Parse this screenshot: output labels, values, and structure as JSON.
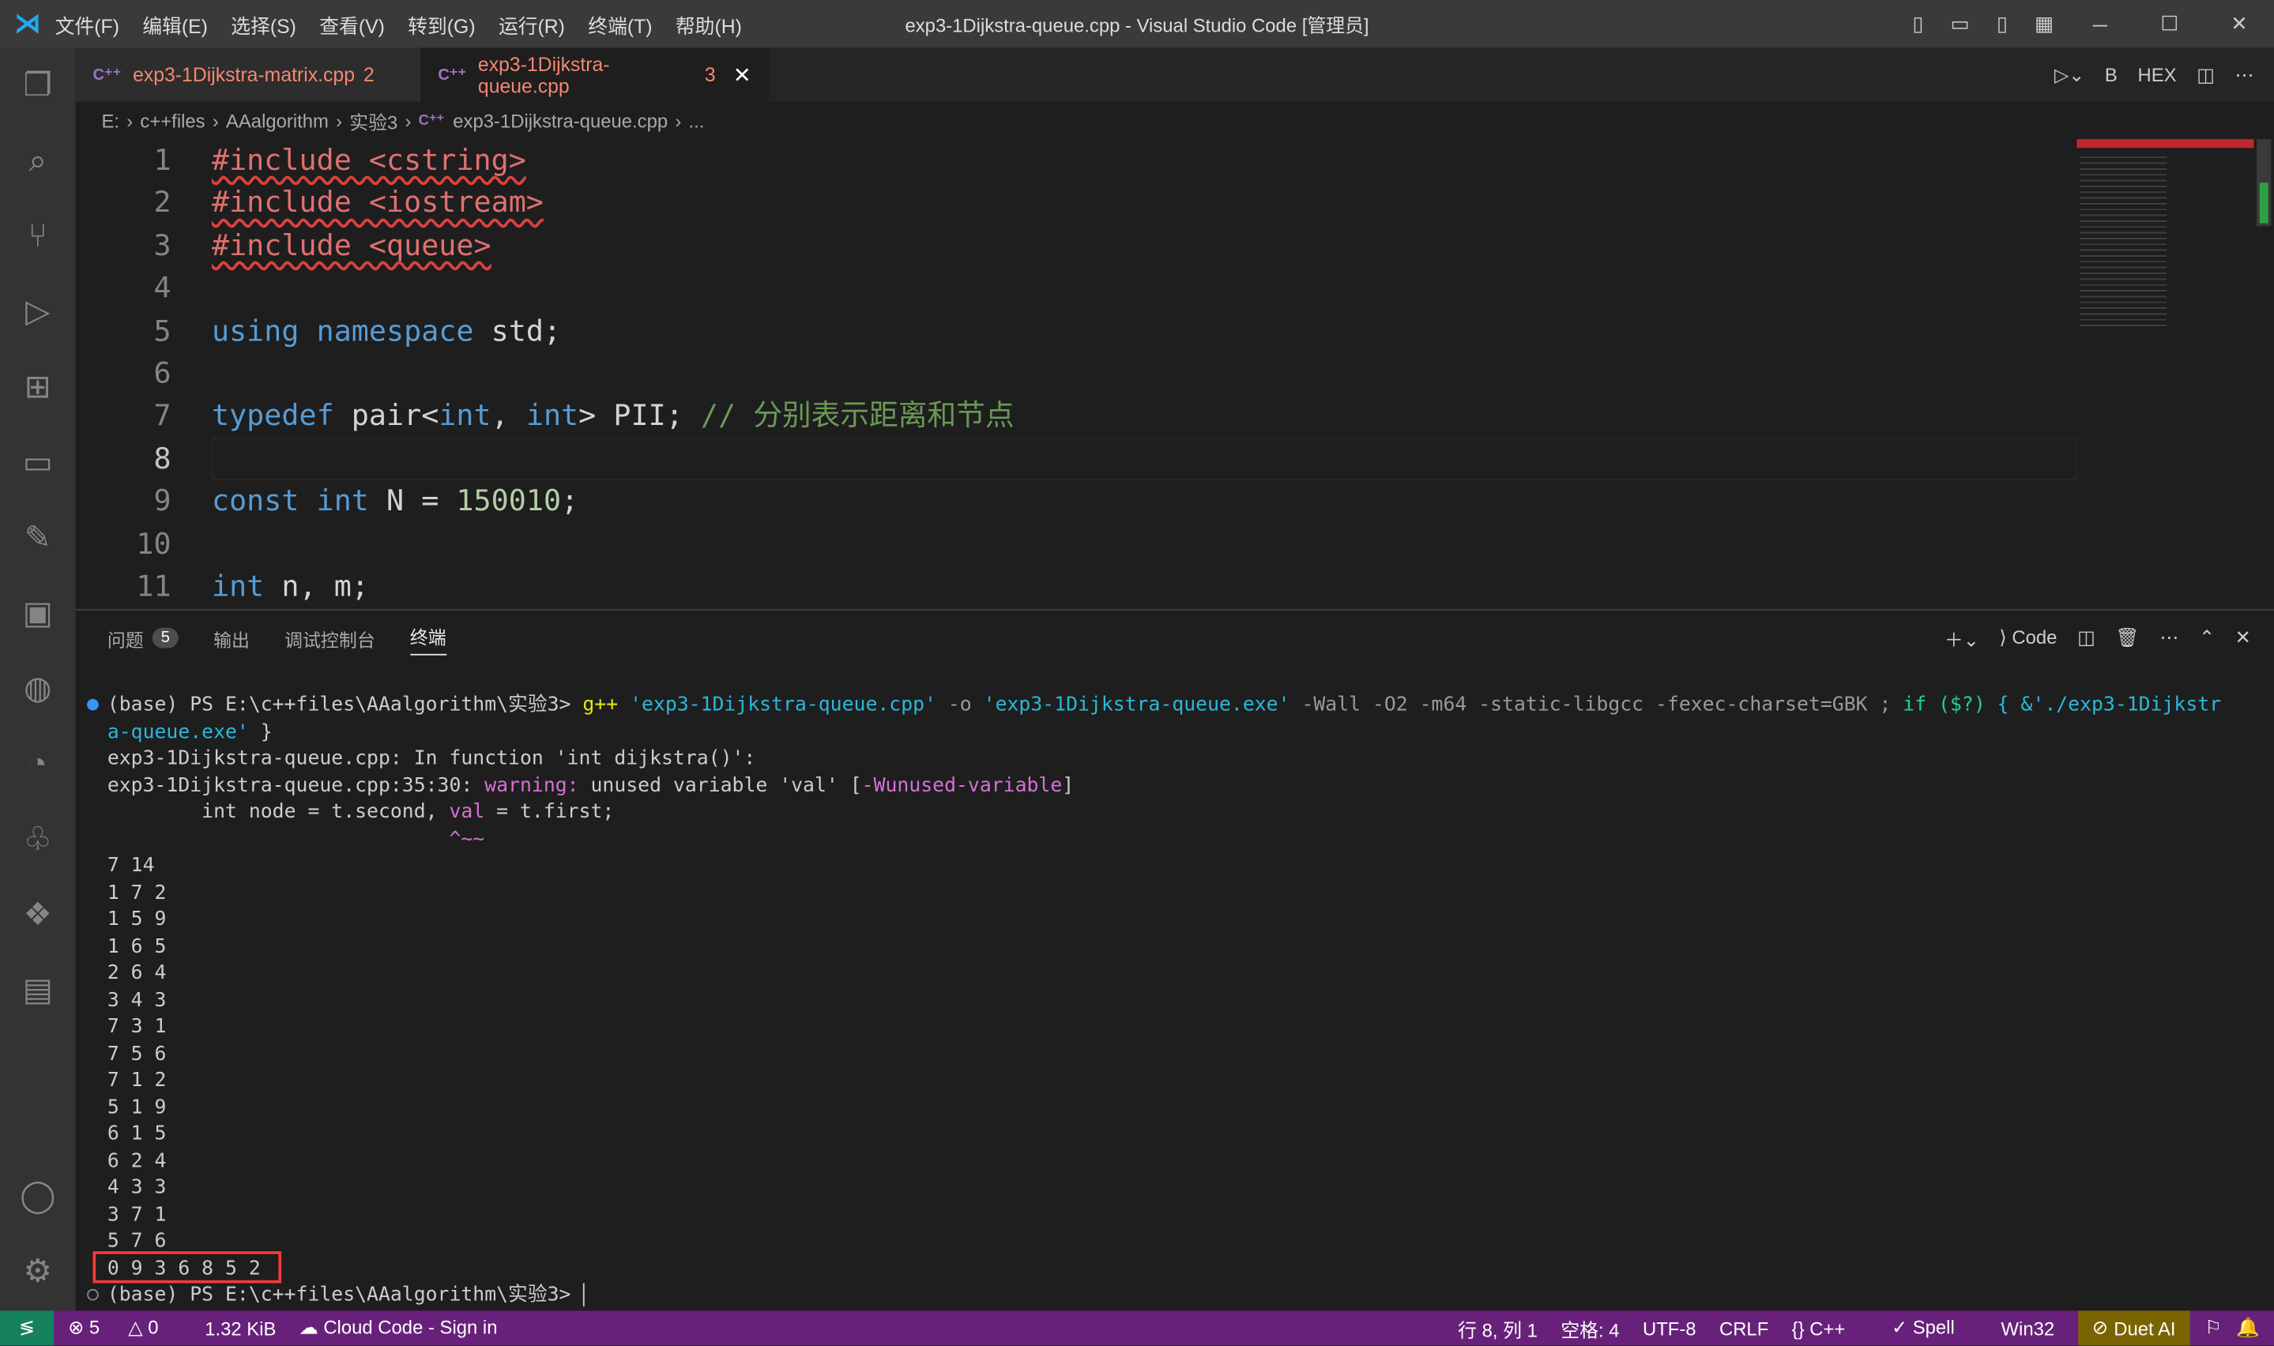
{
  "window": {
    "title": "exp3-1Dijkstra-queue.cpp - Visual Studio Code [管理员]"
  },
  "menu": [
    "文件(F)",
    "编辑(E)",
    "选择(S)",
    "查看(V)",
    "转到(G)",
    "运行(R)",
    "终端(T)",
    "帮助(H)"
  ],
  "tabs": [
    {
      "label": "exp3-1Dijkstra-matrix.cpp",
      "problems": "2",
      "active": false
    },
    {
      "label": "exp3-1Dijkstra-queue.cpp",
      "problems": "3",
      "active": true
    }
  ],
  "editor_tools": {
    "bold": "B",
    "hex": "HEX"
  },
  "breadcrumb": [
    "E:",
    "c++files",
    "AAalgorithm",
    "实验3",
    "exp3-1Dijkstra-queue.cpp",
    "..."
  ],
  "code": {
    "line_numbers": [
      "1",
      "2",
      "3",
      "4",
      "5",
      "6",
      "7",
      "8",
      "9",
      "10",
      "11"
    ],
    "l1": "#include <cstring>",
    "l2": "#include <iostream>",
    "l3": "#include <queue>",
    "l5a": "using namespace",
    "l5b": " std;",
    "l7a": "typedef",
    "l7b": " pair<",
    "l7c": "int",
    ", ": ", ",
    "l7d": "int",
    "l7e": "> PII; ",
    "l7f": "// 分别表示距离和节点",
    "l9a": "const int",
    "l9b": " N = ",
    "l9c": "150010",
    "l9d": ";",
    "l11a": "int",
    "l11b": " n, m;",
    "current_line": "8"
  },
  "panel": {
    "tabs": [
      {
        "label": "问题",
        "badge": "5"
      },
      {
        "label": "输出"
      },
      {
        "label": "调试控制台"
      },
      {
        "label": "终端",
        "active": true
      }
    ],
    "terminal_name": "Code"
  },
  "terminal": {
    "cmd_prompt": "(base) PS E:\\c++files\\AAalgorithm\\实验3> ",
    "cmd_gpp": "g++",
    "cmd_src": " 'exp3-1Dijkstra-queue.cpp'",
    "cmd_o": " -o",
    "cmd_exe": " 'exp3-1Dijkstra-queue.exe'",
    "cmd_flags": " -Wall -O2 -m64 -static-libgcc -fexec-charset=GBK ; ",
    "cmd_if": "if",
    "cmd_cond": " ($?)",
    "cmd_run": " { &'./exp3-1Dijkstr",
    "cmd_run2": "a-queue.exe'",
    " cmd_close": " }",
    "cmd_close": " }",
    "msg1": "exp3-1Dijkstra-queue.cpp: In function 'int dijkstra()':",
    "msg2a": "exp3-1Dijkstra-queue.cpp:35:30: ",
    "msg2b": "warning:",
    "msg2c": " unused variable 'val' [",
    "msg2d": "-Wunused-variable",
    "msg2e": "]",
    "msg3a": "        int node = t.second, ",
    "msg3b": "val",
    "msg3c": " = t.first;",
    "msg4": "                             ^~~",
    "input": [
      "7 14",
      "1 7 2",
      "1 5 9",
      "1 6 5",
      "2 6 4",
      "3 4 3",
      "7 3 1",
      "7 5 6",
      "7 1 2",
      "5 1 9",
      "6 1 5",
      "6 2 4",
      "4 3 3",
      "3 7 1",
      "5 7 6"
    ],
    "output": "0 9 3 6 8 5 2",
    "prompt": "(base) PS E:\\c++files\\AAalgorithm\\实验3> "
  },
  "status": {
    "errors": "5",
    "warnings": "0",
    "size": "1.32 KiB",
    "cloud": "Cloud Code - Sign in",
    "position": "行 8, 列 1",
    "spaces": "空格: 4",
    "encoding": "UTF-8",
    "eol": "CRLF",
    "language": "C++",
    "spell": "Spell",
    "platform": "Win32",
    "duet": "Duet AI"
  },
  "colors": {
    "status_bar": "#68217a",
    "remote": "#16825d",
    "highlight_box": "#f23b3b"
  }
}
